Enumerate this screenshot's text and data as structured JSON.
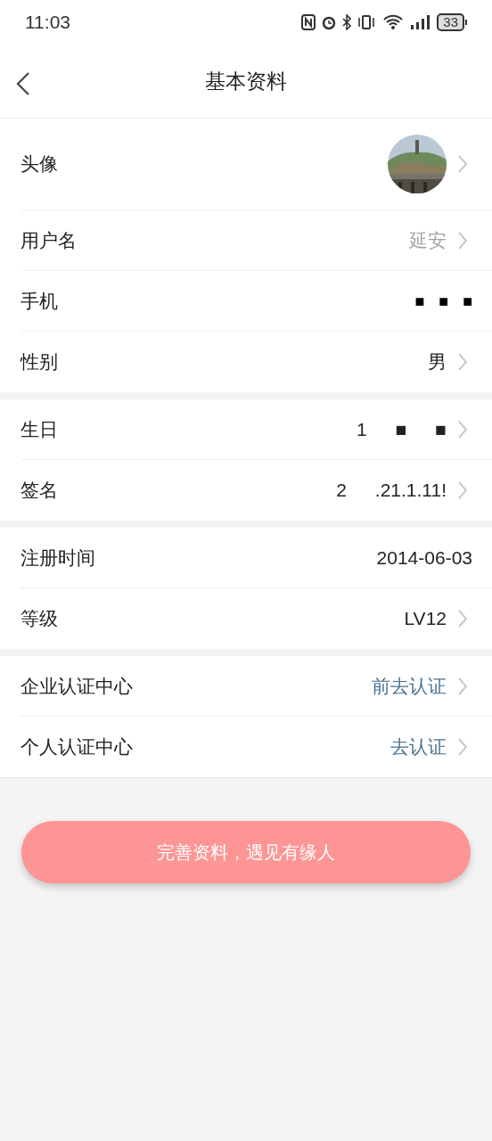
{
  "status_bar": {
    "time": "11:03",
    "battery": "33"
  },
  "header": {
    "title": "基本资料"
  },
  "sections": [
    {
      "rows": [
        {
          "kind": "avatar",
          "label": "头像",
          "chevron": true
        },
        {
          "kind": "text",
          "label": "用户名",
          "parts": [
            "延安"
          ],
          "dimmed": true,
          "link": false,
          "chevron": true
        },
        {
          "kind": "redacted",
          "label": "手机",
          "parts": [
            "■",
            "■",
            "■"
          ],
          "chevron": false
        },
        {
          "kind": "text",
          "label": "性别",
          "parts": [
            "男"
          ],
          "dimmed": false,
          "link": false,
          "chevron": true
        }
      ]
    },
    {
      "rows": [
        {
          "kind": "text",
          "label": "生日",
          "parts": [
            "1",
            "■",
            "■"
          ],
          "dimmed": false,
          "link": false,
          "chevron": true
        },
        {
          "kind": "text",
          "label": "签名",
          "parts": [
            "2",
            ".21.1.11!"
          ],
          "dimmed": false,
          "link": false,
          "chevron": true
        }
      ]
    },
    {
      "rows": [
        {
          "kind": "text",
          "label": "注册时间",
          "parts": [
            "2014-06-03"
          ],
          "dimmed": false,
          "link": false,
          "chevron": false
        },
        {
          "kind": "text",
          "label": "等级",
          "parts": [
            "LV12"
          ],
          "dimmed": false,
          "link": false,
          "chevron": true
        }
      ]
    },
    {
      "rows": [
        {
          "kind": "text",
          "label": "企业认证中心",
          "parts": [
            "前去认证"
          ],
          "dimmed": false,
          "link": true,
          "chevron": true
        },
        {
          "kind": "text",
          "label": "个人认证中心",
          "parts": [
            "去认证"
          ],
          "dimmed": false,
          "link": true,
          "chevron": true
        }
      ]
    }
  ],
  "action_button": "完善资料，遇见有缘人"
}
